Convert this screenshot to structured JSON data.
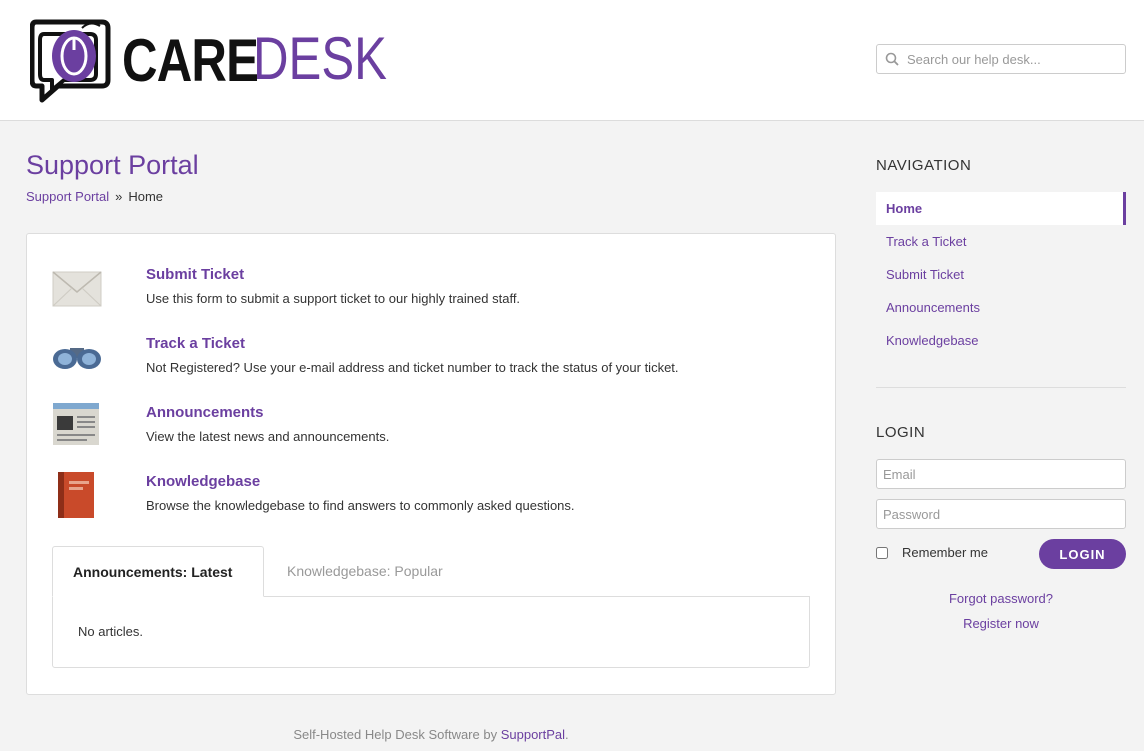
{
  "header": {
    "logo_primary": "CARE",
    "logo_secondary": "DESK",
    "search_placeholder": "Search our help desk..."
  },
  "page": {
    "title": "Support Portal",
    "breadcrumb": {
      "root": "Support Portal",
      "separator": "»",
      "current": "Home"
    }
  },
  "features": [
    {
      "title": "Submit Ticket",
      "description": "Use this form to submit a support ticket to our highly trained staff.",
      "icon": "envelope-icon"
    },
    {
      "title": "Track a Ticket",
      "description": "Not Registered? Use your e-mail address and ticket number to track the status of your ticket.",
      "icon": "binoculars-icon"
    },
    {
      "title": "Announcements",
      "description": "View the latest news and announcements.",
      "icon": "newspaper-icon"
    },
    {
      "title": "Knowledgebase",
      "description": "Browse the knowledgebase to find answers to commonly asked questions.",
      "icon": "book-icon"
    }
  ],
  "tabs": {
    "items": [
      {
        "label": "Announcements: Latest",
        "active": true
      },
      {
        "label": "Knowledgebase: Popular",
        "active": false
      }
    ],
    "content": "No articles."
  },
  "sidebar": {
    "navigation_heading": "NAVIGATION",
    "nav_items": [
      {
        "label": "Home",
        "active": true
      },
      {
        "label": "Track a Ticket",
        "active": false
      },
      {
        "label": "Submit Ticket",
        "active": false
      },
      {
        "label": "Announcements",
        "active": false
      },
      {
        "label": "Knowledgebase",
        "active": false
      }
    ],
    "login": {
      "heading": "LOGIN",
      "email_placeholder": "Email",
      "password_placeholder": "Password",
      "remember_label": "Remember me",
      "button_label": "LOGIN",
      "forgot_label": "Forgot password?",
      "register_label": "Register now"
    }
  },
  "footer": {
    "text": "Self-Hosted Help Desk Software by ",
    "link": "SupportPal",
    "suffix": "."
  },
  "colors": {
    "accent": "#6b3fa0",
    "background": "#f3f3f3"
  }
}
